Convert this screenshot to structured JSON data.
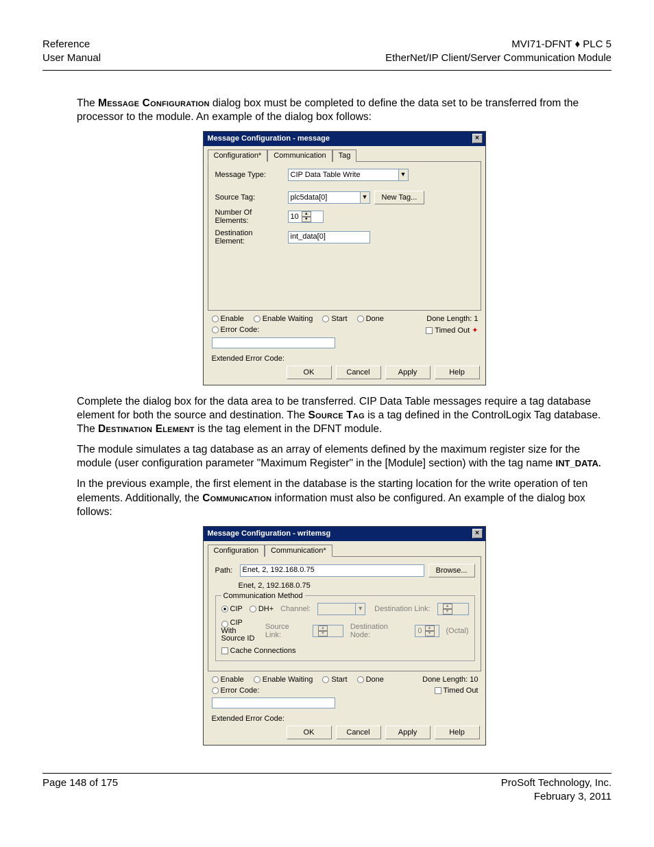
{
  "header": {
    "left1": "Reference",
    "left2": "User Manual",
    "right1": "MVI71-DFNT ♦ PLC 5",
    "right2": "EtherNet/IP Client/Server Communication Module"
  },
  "para1_pre": "The ",
  "para1_sc": "Message Configuration",
  "para1_post": " dialog box must be completed to define the data set to be transferred from the processor to the module. An example of the dialog box follows:",
  "dialog1": {
    "title": "Message Configuration - message",
    "tabs": {
      "t1": "Configuration*",
      "t2": "Communication",
      "t3": "Tag"
    },
    "labels": {
      "msgtype": "Message Type:",
      "srctag": "Source Tag:",
      "numel": "Number Of Elements:",
      "destel": "Destination Element:"
    },
    "values": {
      "msgtype": "CIP Data Table Write",
      "srctag": "plc5data[0]",
      "numel": "10",
      "destel": "int_data[0]"
    },
    "newtag": "New Tag...",
    "status": {
      "enable": "Enable",
      "enablewait": "Enable Waiting",
      "start": "Start",
      "done": "Done",
      "donelen_lbl": "Done Length:",
      "donelen_val": "1",
      "errcode": "Error Code:",
      "timedout": "Timed Out",
      "ext": "Extended Error Code:"
    },
    "btns": {
      "ok": "OK",
      "cancel": "Cancel",
      "apply": "Apply",
      "help": "Help"
    }
  },
  "para2_a": "Complete the dialog box for the data area to be transferred. CIP Data Table messages require a tag database element for both the source and destination. The ",
  "para2_sc1": "Source Tag",
  "para2_b": " is a tag defined in the ControlLogix Tag database. The ",
  "para2_sc2": "Destination Element",
  "para2_c": " is the tag element in the DFNT module.",
  "para3_a": "The module simulates a tag database as an array of elements defined by the maximum register size for the module (user configuration parameter \"Maximum Register\" in the [Module] section) with the tag name ",
  "para3_b": "INT_DATA.",
  "para4_a": "In the previous example, the first element in the database is the starting location for the write operation of ten elements. Additionally, the ",
  "para4_sc": "Communication",
  "para4_b": " information must also be configured. An example of the dialog box follows:",
  "dialog2": {
    "title": "Message Configuration - writemsg",
    "tabs": {
      "t1": "Configuration",
      "t2": "Communication*"
    },
    "path_lbl": "Path:",
    "path_val": "Enet, 2, 192.168.0.75",
    "path_echo": "Enet, 2, 192.168.0.75",
    "browse": "Browse...",
    "cm_legend": "Communication Method",
    "cip": "CIP",
    "dhp": "DH+",
    "channel": "Channel:",
    "destlink": "Destination Link:",
    "cipwith": "CIP With\nSource ID",
    "srclink": "Source Link:",
    "destnode": "Destination Node:",
    "octal": "(Octal)",
    "destnode_val": "0",
    "cache": "Cache Connections",
    "status": {
      "enable": "Enable",
      "enablewait": "Enable Waiting",
      "start": "Start",
      "done": "Done",
      "donelen_lbl": "Done Length:",
      "donelen_val": "10",
      "errcode": "Error Code:",
      "timedout": "Timed Out",
      "ext": "Extended Error Code:"
    },
    "btns": {
      "ok": "OK",
      "cancel": "Cancel",
      "apply": "Apply",
      "help": "Help"
    }
  },
  "footer": {
    "left": "Page 148 of 175",
    "right1": "ProSoft Technology, Inc.",
    "right2": "February 3, 2011"
  }
}
